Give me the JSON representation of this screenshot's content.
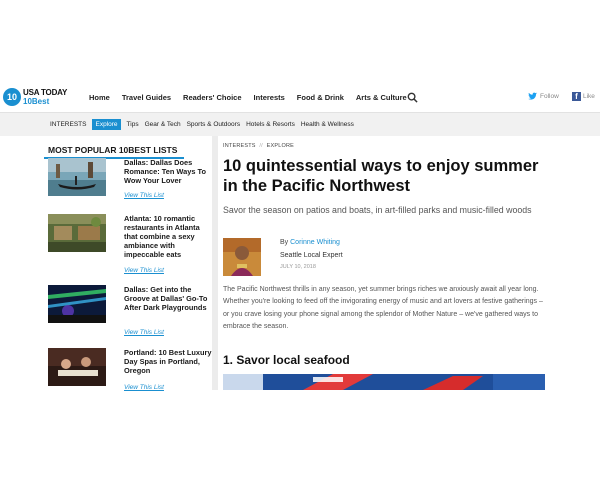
{
  "brand": {
    "badge": "10",
    "top": "USA TODAY",
    "bottom": "10Best"
  },
  "nav": {
    "items": [
      "Home",
      "Travel Guides",
      "Readers' Choice",
      "Interests",
      "Food & Drink",
      "Arts & Culture"
    ],
    "search_icon": "search-icon",
    "twitter_label": "Follow",
    "facebook_label": "Like"
  },
  "subnav": {
    "label": "INTERESTS",
    "items": [
      "Explore",
      "Tips",
      "Gear & Tech",
      "Sports & Outdoors",
      "Hotels & Resorts",
      "Health & Wellness"
    ],
    "active_index": 0
  },
  "sidebar": {
    "title": "MOST POPULAR 10BEST LISTS",
    "items": [
      {
        "title": "Dallas: Dallas Does Romance: Ten Ways To Wow Your Lover",
        "link": "View This List"
      },
      {
        "title": "Atlanta: 10 romantic restaurants in Atlanta that combine a sexy ambiance with impeccable eats",
        "link": "View This List"
      },
      {
        "title": "Dallas: Get into the Groove at Dallas' Go-To After Dark Playgrounds",
        "link": "View This List"
      },
      {
        "title": "Portland: 10 Best Luxury Day Spas in Portland, Oregon",
        "link": "View This List"
      }
    ]
  },
  "article": {
    "crumb_a": "INTERESTS",
    "crumb_sep": "//",
    "crumb_b": "EXPLORE",
    "headline": "10 quintessential ways to enjoy summer in the Pacific Northwest",
    "dek": "Savor the season on patios and boats, in art-filled parks and music-filled woods",
    "by_prefix": "By",
    "author": "Corinne Whiting",
    "role": "Seattle Local Expert",
    "date": "JULY 10, 2018",
    "body": "The Pacific Northwest thrills in any season, yet summer brings riches we anxiously await all year long. Whether you're looking to feed off the invigorating energy of music and art lovers at festive gatherings – or you crave losing your phone signal among the splendor of Mother Nature – we've gathered ways to embrace the season.",
    "section_heading": "1. Savor local seafood"
  },
  "colors": {
    "accent": "#1a8fd0",
    "subnav_bg": "#f1f1f1"
  }
}
